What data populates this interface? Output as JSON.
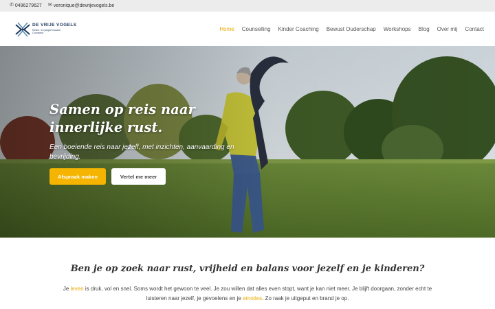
{
  "topbar": {
    "phone": "0496279627",
    "phone_icon": "phone-icon",
    "email": "veronique@devrijevogels.be",
    "email_icon": "envelope-icon"
  },
  "logo": {
    "title": "DE VRIJE VOGELS",
    "subtitle_1": "Kinder- en jongerencoach",
    "subtitle_2": "Counselor"
  },
  "nav": {
    "items": [
      "Home",
      "Counselling",
      "Kinder Coaching",
      "Bewust Ouderschap",
      "Workshops",
      "Blog",
      "Over mij",
      "Contact"
    ],
    "active": "Home"
  },
  "hero": {
    "title_line1": "Samen op reis naar",
    "title_line2": "innerlijke rust.",
    "subtitle": "Een boeiende reis naar jezelf, met inzichten, aanvaarding en bevrijding.",
    "primary_button": "Afspraak maken",
    "secondary_button": "Vertel me meer"
  },
  "intro": {
    "heading": "Ben je op zoek naar rust, vrijheid en balans voor jezelf en je kinderen?",
    "p1_a": "Je ",
    "p1_link1": "leven",
    "p1_b": " is druk, vol en snel. Soms wordt het gewoon te veel. Je zou willen dat alles even stopt, want je kan niet meer. Je blijft doorgaan, zonder echt te luisteren naar jezelf, je gevoelens en je ",
    "p1_link2": "emoties",
    "p1_c": ". Zo raak je uitgeput en brand je op."
  },
  "colors": {
    "accent": "#f4b400",
    "nav_active": "#e6ac00",
    "topbar_bg": "#ececec",
    "logo_blue": "#1d3a5f"
  }
}
